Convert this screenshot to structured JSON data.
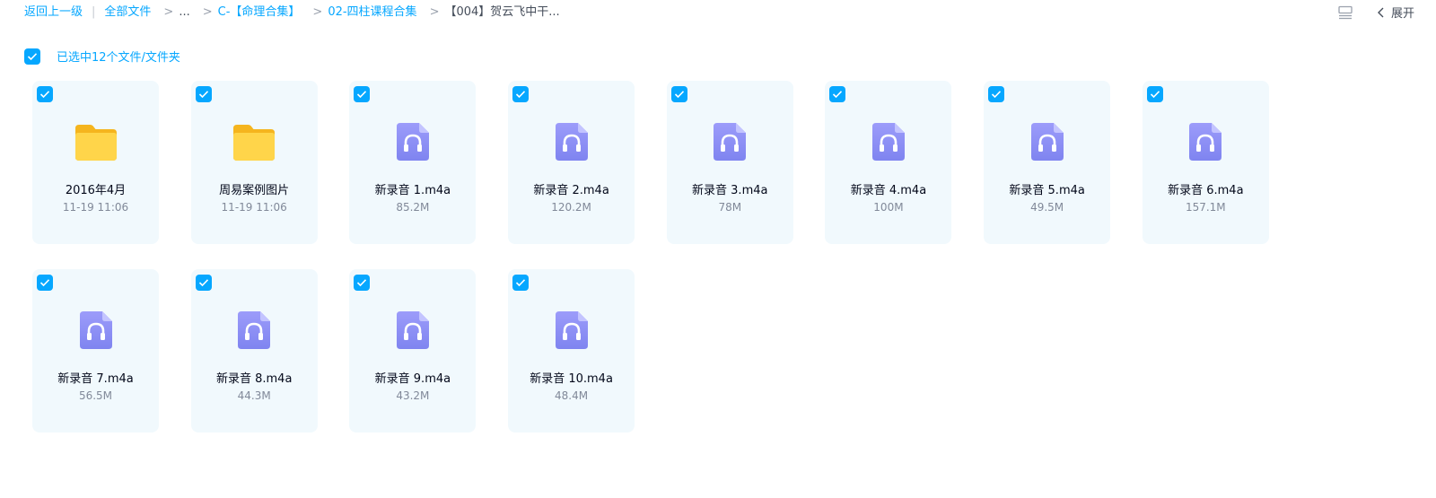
{
  "breadcrumb": {
    "back": "返回上一级",
    "root": "全部文件",
    "ellipsis": "...",
    "sep": ">",
    "divider": "|",
    "items": [
      "C-【命理合集】",
      "02-四柱课程合集"
    ],
    "current": "【004】贺云飞中干..."
  },
  "toolbar": {
    "list_view_icon": "list-view-icon",
    "collapse_label": "展开"
  },
  "selection": {
    "label": "已选中12个文件/文件夹"
  },
  "colors": {
    "accent": "#06a7ff",
    "card_bg": "#f1f9fd",
    "folder": "#ffc53d",
    "audio": "#8c8cf5"
  },
  "files": [
    {
      "name": "2016年4月",
      "meta": "11-19 11:06",
      "type": "folder"
    },
    {
      "name": "周易案例图片",
      "meta": "11-19 11:06",
      "type": "folder"
    },
    {
      "name": "新录音 1.m4a",
      "meta": "85.2M",
      "type": "audio"
    },
    {
      "name": "新录音 2.m4a",
      "meta": "120.2M",
      "type": "audio"
    },
    {
      "name": "新录音 3.m4a",
      "meta": "78M",
      "type": "audio"
    },
    {
      "name": "新录音 4.m4a",
      "meta": "100M",
      "type": "audio"
    },
    {
      "name": "新录音 5.m4a",
      "meta": "49.5M",
      "type": "audio"
    },
    {
      "name": "新录音 6.m4a",
      "meta": "157.1M",
      "type": "audio"
    },
    {
      "name": "新录音 7.m4a",
      "meta": "56.5M",
      "type": "audio"
    },
    {
      "name": "新录音 8.m4a",
      "meta": "44.3M",
      "type": "audio"
    },
    {
      "name": "新录音 9.m4a",
      "meta": "43.2M",
      "type": "audio"
    },
    {
      "name": "新录音 10.m4a",
      "meta": "48.4M",
      "type": "audio"
    }
  ]
}
